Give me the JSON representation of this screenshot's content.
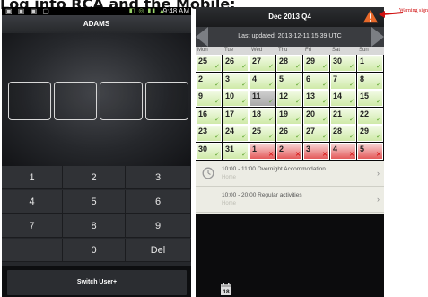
{
  "heading": "Log into RCA and the Mobile:",
  "left": {
    "status": {
      "icons_left": "▣ ▣ ▣ ▢",
      "icons_right": "◧ ◎ ▮▮ ▲",
      "time": "9:48 AM"
    },
    "title": "ADAMS",
    "pin_boxes": 4,
    "keys": [
      "1",
      "2",
      "3",
      "4",
      "5",
      "6",
      "7",
      "8",
      "9",
      "",
      "0",
      "Del"
    ],
    "switch_label": "Switch User+"
  },
  "right": {
    "title": "Dec 2013 Q4",
    "updated": "Last updated: 2013-12-11 15:39 UTC",
    "weekdays": [
      "Mon",
      "Tue",
      "Wed",
      "Thu",
      "Fri",
      "Sat",
      "Sun"
    ],
    "weeks": [
      [
        {
          "d": "25",
          "s": "ok"
        },
        {
          "d": "26",
          "s": "ok"
        },
        {
          "d": "27",
          "s": "ok"
        },
        {
          "d": "28",
          "s": "ok"
        },
        {
          "d": "29",
          "s": "ok"
        },
        {
          "d": "30",
          "s": "ok"
        },
        {
          "d": "1",
          "s": "ok"
        }
      ],
      [
        {
          "d": "2",
          "s": "ok"
        },
        {
          "d": "3",
          "s": "ok"
        },
        {
          "d": "4",
          "s": "ok"
        },
        {
          "d": "5",
          "s": "ok"
        },
        {
          "d": "6",
          "s": "ok"
        },
        {
          "d": "7",
          "s": "ok"
        },
        {
          "d": "8",
          "s": "ok"
        }
      ],
      [
        {
          "d": "9",
          "s": "ok"
        },
        {
          "d": "10",
          "s": "ok"
        },
        {
          "d": "11",
          "s": "today"
        },
        {
          "d": "12",
          "s": "ok"
        },
        {
          "d": "13",
          "s": "ok"
        },
        {
          "d": "14",
          "s": "ok"
        },
        {
          "d": "15",
          "s": "ok"
        }
      ],
      [
        {
          "d": "16",
          "s": "ok"
        },
        {
          "d": "17",
          "s": "ok"
        },
        {
          "d": "18",
          "s": "ok"
        },
        {
          "d": "19",
          "s": "ok"
        },
        {
          "d": "20",
          "s": "ok"
        },
        {
          "d": "21",
          "s": "ok"
        },
        {
          "d": "22",
          "s": "ok"
        }
      ],
      [
        {
          "d": "23",
          "s": "ok"
        },
        {
          "d": "24",
          "s": "ok"
        },
        {
          "d": "25",
          "s": "ok"
        },
        {
          "d": "26",
          "s": "ok"
        },
        {
          "d": "27",
          "s": "ok"
        },
        {
          "d": "28",
          "s": "ok"
        },
        {
          "d": "29",
          "s": "ok"
        }
      ],
      [
        {
          "d": "30",
          "s": "ok"
        },
        {
          "d": "31",
          "s": "ok"
        },
        {
          "d": "1",
          "s": "bad"
        },
        {
          "d": "2",
          "s": "bad"
        },
        {
          "d": "3",
          "s": "bad"
        },
        {
          "d": "4",
          "s": "bad"
        },
        {
          "d": "5",
          "s": "bad"
        }
      ]
    ],
    "events": [
      {
        "time": "10:00 - 11:00",
        "title": "Overnight Accommodation",
        "place": "Home"
      },
      {
        "time": "10:00 - 20:00",
        "title": "Regular activities",
        "place": "Home"
      }
    ],
    "bottom_icon_text": "18"
  },
  "annotation": {
    "warning_label": "Warning sign",
    "color": "#d01010"
  },
  "colors": {
    "ok": "#cfeaa8",
    "bad": "#e45a5a",
    "check": "#58a229",
    "cross": "#d81d1d"
  }
}
